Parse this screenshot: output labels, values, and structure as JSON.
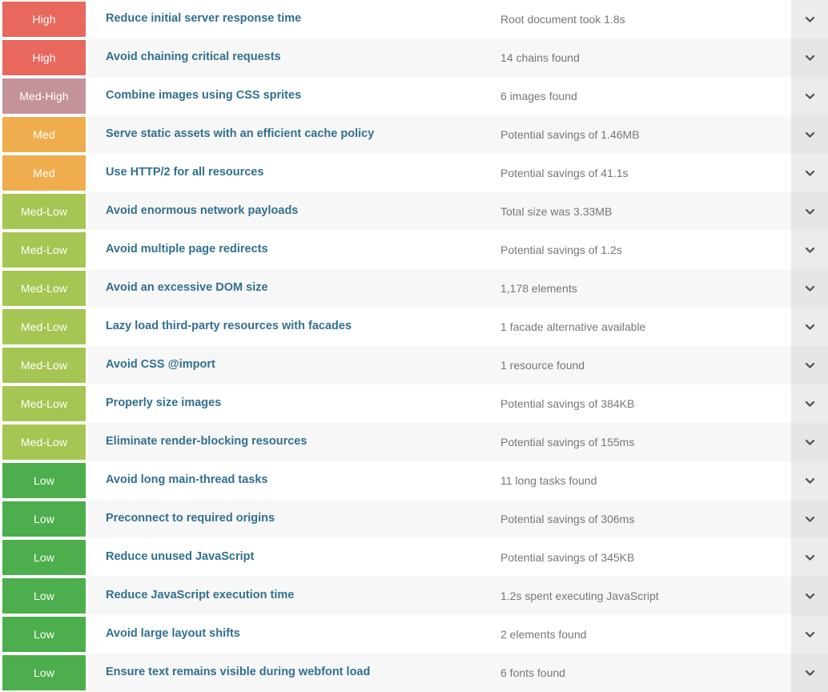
{
  "palette": {
    "high": "#e8685d",
    "med_high": "#c4929a",
    "med": "#f0ad4e",
    "med_low": "#a5c653",
    "low": "#4cae4c",
    "title_text": "#31708f",
    "desc_text": "#777777",
    "row_bg": "#ffffff",
    "row_bg_alt": "#f7f7f7",
    "chevron_bg": "#ececec"
  },
  "icons": {
    "expand": "chevron-down-icon"
  },
  "audits": [
    {
      "severity": "High",
      "severity_key": "high",
      "title": "Reduce initial server response time",
      "description": "Root document took 1.8s"
    },
    {
      "severity": "High",
      "severity_key": "high",
      "title": "Avoid chaining critical requests",
      "description": "14 chains found"
    },
    {
      "severity": "Med-High",
      "severity_key": "med-high",
      "title": "Combine images using CSS sprites",
      "description": "6 images found"
    },
    {
      "severity": "Med",
      "severity_key": "med",
      "title": "Serve static assets with an efficient cache policy",
      "description": "Potential savings of 1.46MB"
    },
    {
      "severity": "Med",
      "severity_key": "med",
      "title": "Use HTTP/2 for all resources",
      "description": "Potential savings of 41.1s"
    },
    {
      "severity": "Med-Low",
      "severity_key": "med-low",
      "title": "Avoid enormous network payloads",
      "description": "Total size was 3.33MB"
    },
    {
      "severity": "Med-Low",
      "severity_key": "med-low",
      "title": "Avoid multiple page redirects",
      "description": "Potential savings of 1.2s"
    },
    {
      "severity": "Med-Low",
      "severity_key": "med-low",
      "title": "Avoid an excessive DOM size",
      "description": "1,178 elements"
    },
    {
      "severity": "Med-Low",
      "severity_key": "med-low",
      "title": "Lazy load third-party resources with facades",
      "description": "1 facade alternative available"
    },
    {
      "severity": "Med-Low",
      "severity_key": "med-low",
      "title": "Avoid CSS @import",
      "description": "1 resource found"
    },
    {
      "severity": "Med-Low",
      "severity_key": "med-low",
      "title": "Properly size images",
      "description": "Potential savings of 384KB"
    },
    {
      "severity": "Med-Low",
      "severity_key": "med-low",
      "title": "Eliminate render-blocking resources",
      "description": "Potential savings of 155ms"
    },
    {
      "severity": "Low",
      "severity_key": "low",
      "title": "Avoid long main-thread tasks",
      "description": "11 long tasks found"
    },
    {
      "severity": "Low",
      "severity_key": "low",
      "title": "Preconnect to required origins",
      "description": "Potential savings of 306ms"
    },
    {
      "severity": "Low",
      "severity_key": "low",
      "title": "Reduce unused JavaScript",
      "description": "Potential savings of 345KB"
    },
    {
      "severity": "Low",
      "severity_key": "low",
      "title": "Reduce JavaScript execution time",
      "description": "1.2s spent executing JavaScript"
    },
    {
      "severity": "Low",
      "severity_key": "low",
      "title": "Avoid large layout shifts",
      "description": "2 elements found"
    },
    {
      "severity": "Low",
      "severity_key": "low",
      "title": "Ensure text remains visible during webfont load",
      "description": "6 fonts found"
    }
  ]
}
